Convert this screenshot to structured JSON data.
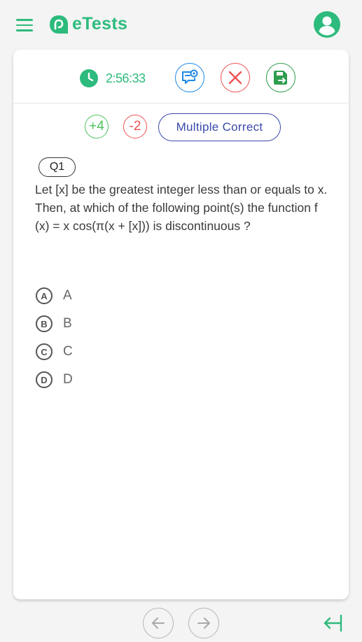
{
  "app": {
    "name": "eTests"
  },
  "header": {
    "menu_icon": "hamburger-menu-icon",
    "profile_icon": "user-profile-icon"
  },
  "timer": {
    "icon": "clock-icon",
    "value": "2:56:33"
  },
  "actions": [
    {
      "name": "hint",
      "icon": "speech-bubble-hint-icon",
      "color": "#1e88e5"
    },
    {
      "name": "close",
      "icon": "close-x-icon",
      "color": "#f05252"
    },
    {
      "name": "save",
      "icon": "save-floppy-icon",
      "color": "#2e9d4e"
    }
  ],
  "marking": {
    "positive": "+4",
    "negative": "-2",
    "type": "Multiple Correct"
  },
  "question": {
    "number": "Q1",
    "text": "Let [x] be the greatest integer less than or equals to x. Then, at which of the following point(s) the function f (x) = x cos(π(x + [x])) is discontinuous ?"
  },
  "options": [
    {
      "letter": "A",
      "label": "A"
    },
    {
      "letter": "B",
      "label": "B"
    },
    {
      "letter": "C",
      "label": "C"
    },
    {
      "letter": "D",
      "label": "D"
    }
  ],
  "navigation": {
    "prev_icon": "arrow-left-icon",
    "next_icon": "arrow-right-icon",
    "collapse_icon": "collapse-panel-icon"
  },
  "colors": {
    "brand": "#2dbb7d",
    "accent_blue": "#3949ab",
    "positive": "#4cc15c",
    "negative": "#ef5350"
  }
}
